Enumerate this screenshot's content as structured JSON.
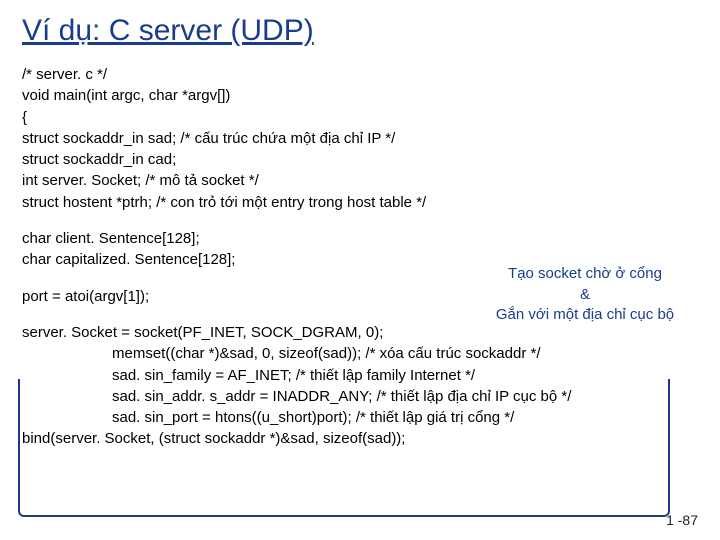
{
  "title": "Ví dụ: C server (UDP)",
  "code": {
    "l1": "/* server. c  */",
    "l2": "void main(int argc, char *argv[])",
    "l3": "{",
    "l4": "struct sockaddr_in sad; /* cấu trúc chứa một địa chỉ IP */",
    "l5": "struct sockaddr_in cad;",
    "l6": "int server. Socket; /* mô tả socket */",
    "l7": "struct hostent *ptrh; /* con trỏ tới một entry trong host table */",
    "l8": "char client. Sentence[128];",
    "l9": "char capitalized. Sentence[128];",
    "l10": "port = atoi(argv[1]);",
    "l11": "server. Socket = socket(PF_INET, SOCK_DGRAM, 0);",
    "l12": "memset((char *)&sad, 0, sizeof(sad)); /* xóa cấu trúc sockaddr */",
    "l13": "sad. sin_family = AF_INET; /* thiết lập family Internet */",
    "l14": "sad. sin_addr. s_addr = INADDR_ANY; /* thiết lập địa chỉ IP cục bộ */",
    "l15": "sad. sin_port = htons((u_short)port); /* thiết lập giá trị cổng */",
    "l16": "bind(server. Socket, (struct sockaddr *)&sad, sizeof(sad));"
  },
  "callout": {
    "line1": "Tạo socket chờ ở cổng",
    "line2": "&",
    "line3": "Gắn với một địa chỉ cục bộ"
  },
  "pagenum": "1 -87"
}
